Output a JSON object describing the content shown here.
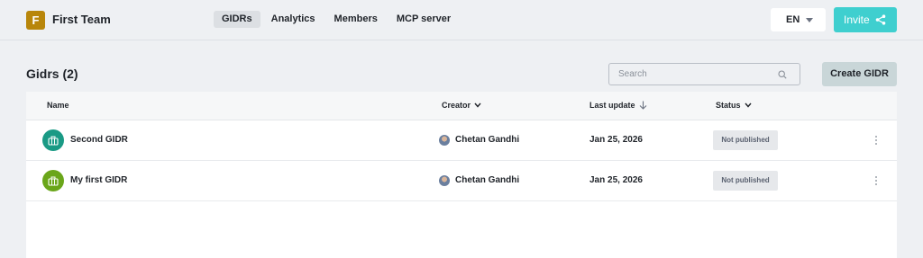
{
  "header": {
    "team_initial": "F",
    "team_name": "First Team",
    "nav": [
      {
        "label": "GIDRs",
        "active": true
      },
      {
        "label": "Analytics",
        "active": false
      },
      {
        "label": "Members",
        "active": false
      },
      {
        "label": "MCP server",
        "active": false
      }
    ],
    "language": "EN",
    "invite_label": "Invite",
    "colors": {
      "badge": "#b8860b",
      "invite": "#3fcfcf"
    }
  },
  "page": {
    "title": "Gidrs (2)",
    "search_placeholder": "Search",
    "search_value": "",
    "create_label": "Create GIDR"
  },
  "table": {
    "columns": {
      "name": "Name",
      "creator": "Creator",
      "last_update": "Last update",
      "status": "Status"
    },
    "rows": [
      {
        "name": "Second GIDR",
        "icon": "briefcase-icon",
        "icon_color": "#1a9a85",
        "creator": "Chetan Gandhi",
        "last_update": "Jan 25, 2026",
        "status": "Not published"
      },
      {
        "name": "My first GIDR",
        "icon": "briefcase-icon",
        "icon_color": "#6aa61a",
        "creator": "Chetan Gandhi",
        "last_update": "Jan 25, 2026",
        "status": "Not published"
      }
    ]
  }
}
